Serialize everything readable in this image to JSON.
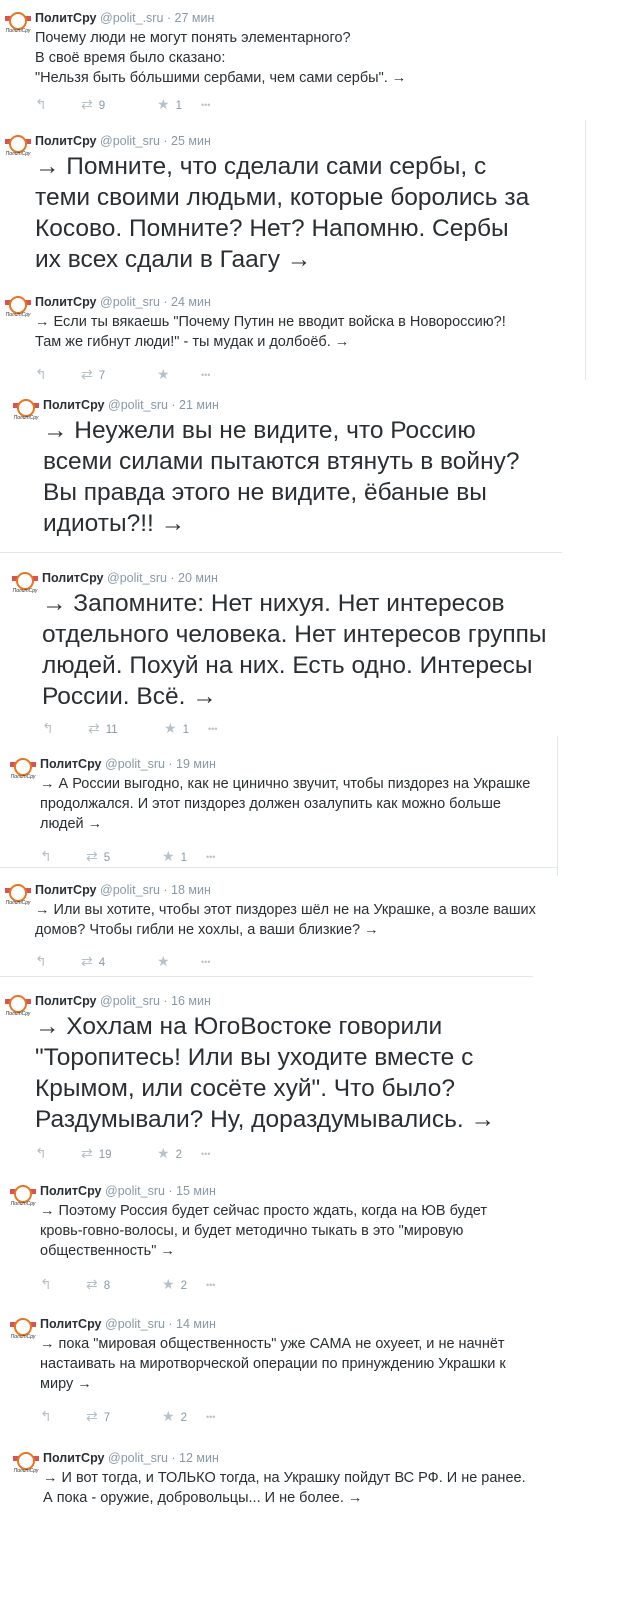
{
  "account": {
    "name": "ПолитСру",
    "handle_t1": "@polit_.sru",
    "handle": "@polit_sru",
    "avatar_caption": "ПолитСру"
  },
  "icons": {
    "reply": "reply-icon",
    "retweet": "retweet-icon",
    "favorite": "star-icon",
    "more": "more-icon"
  },
  "tweets": [
    {
      "time": "27 мин",
      "lines": [
        "Почему люди не могут понять элементарного?",
        "В своё время было сказано:",
        "\"Нельзя быть бо́льшими сербами, чем сами сербы\". →"
      ],
      "retweets": "9",
      "favorites": "1"
    },
    {
      "time": "25 мин",
      "lines": [
        "→ Помните, что сделали сами сербы, с",
        "теми своими людьми, которые боролись за",
        "Косово. Помните? Нет? Напомню. Сербы",
        "их всех сдали в Гаагу →"
      ],
      "retweets": "",
      "favorites": ""
    },
    {
      "time": "24 мин",
      "lines": [
        "→ Если ты вякаешь \"Почему Путин не вводит войска в Новороссию?!",
        "Там же гибнут люди!\" - ты мудак и долбоёб. →"
      ],
      "retweets": "7",
      "favorites": ""
    },
    {
      "time": "21 мин",
      "lines": [
        "→ Неужели вы не видите, что Россию",
        "всеми силами пытаются втянуть в войну?",
        "Вы правда этого не видите, ёбаные вы",
        "идиоты?!! →"
      ],
      "retweets": "",
      "favorites": ""
    },
    {
      "time": "20 мин",
      "lines": [
        "→ Запомните: Нет нихуя. Нет интересов",
        "отдельного человека. Нет интересов группы",
        "людей. Похуй на них. Есть одно. Интересы",
        "России. Всё. →"
      ],
      "retweets": "11",
      "favorites": "1"
    },
    {
      "time": "19 мин",
      "lines": [
        "→ А России выгодно, как не цинично звучит, чтобы пиздорез на Украшке",
        "продолжался. И этот пиздорез должен озалупить как можно больше",
        "людей →"
      ],
      "retweets": "5",
      "favorites": "1"
    },
    {
      "time": "18 мин",
      "lines": [
        "→ Или вы хотите, чтобы этот пиздорез шёл не на Украшке, а возле ваших",
        "домов? Чтобы гибли не хохлы, а ваши близкие? →"
      ],
      "retweets": "4",
      "favorites": ""
    },
    {
      "time": "16 мин",
      "lines": [
        "→ Хохлам на ЮгоВостоке говорили",
        "\"Торопитесь! Или вы уходите вместе с",
        "Крымом, или сосёте хуй\". Что было?",
        "Раздумывали? Ну, дораздумывались. →"
      ],
      "retweets": "19",
      "favorites": "2"
    },
    {
      "time": "15 мин",
      "lines": [
        "→ Поэтому Россия будет сейчас просто ждать, когда на ЮВ будет",
        "кровь-говно-волосы, и будет методично тыкать в это \"мировую",
        "общественность\" →"
      ],
      "retweets": "8",
      "favorites": "2"
    },
    {
      "time": "14 мин",
      "lines": [
        "→ пока \"мировая общественность\" уже САМА не охуеет, и не начнёт",
        "настаивать на миротворческой операции  по принуждению Украшки к",
        "миру →"
      ],
      "retweets": "7",
      "favorites": "2"
    },
    {
      "time": "12 мин",
      "lines": [
        "→ И вот тогда, и ТОЛЬКО тогда, на Украшку пойдут ВС РФ. И не ранее.",
        "А пока - оружие, добровольцы... И не более. →"
      ],
      "retweets": "",
      "favorites": ""
    }
  ]
}
